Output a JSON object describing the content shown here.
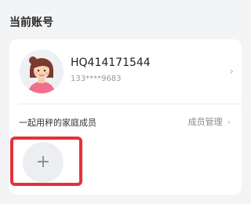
{
  "section": {
    "title": "当前账号"
  },
  "account": {
    "username": "HQ414171544",
    "phone": "133****9683",
    "chevron": "›"
  },
  "family": {
    "label": "一起用秤的家庭成员",
    "manage_label": "成员管理",
    "manage_chevron": "›",
    "add_icon": "+"
  },
  "colors": {
    "highlight": "#e4323a",
    "avatar_hair": "#7a3b2e",
    "avatar_shirt": "#f06f8c"
  }
}
